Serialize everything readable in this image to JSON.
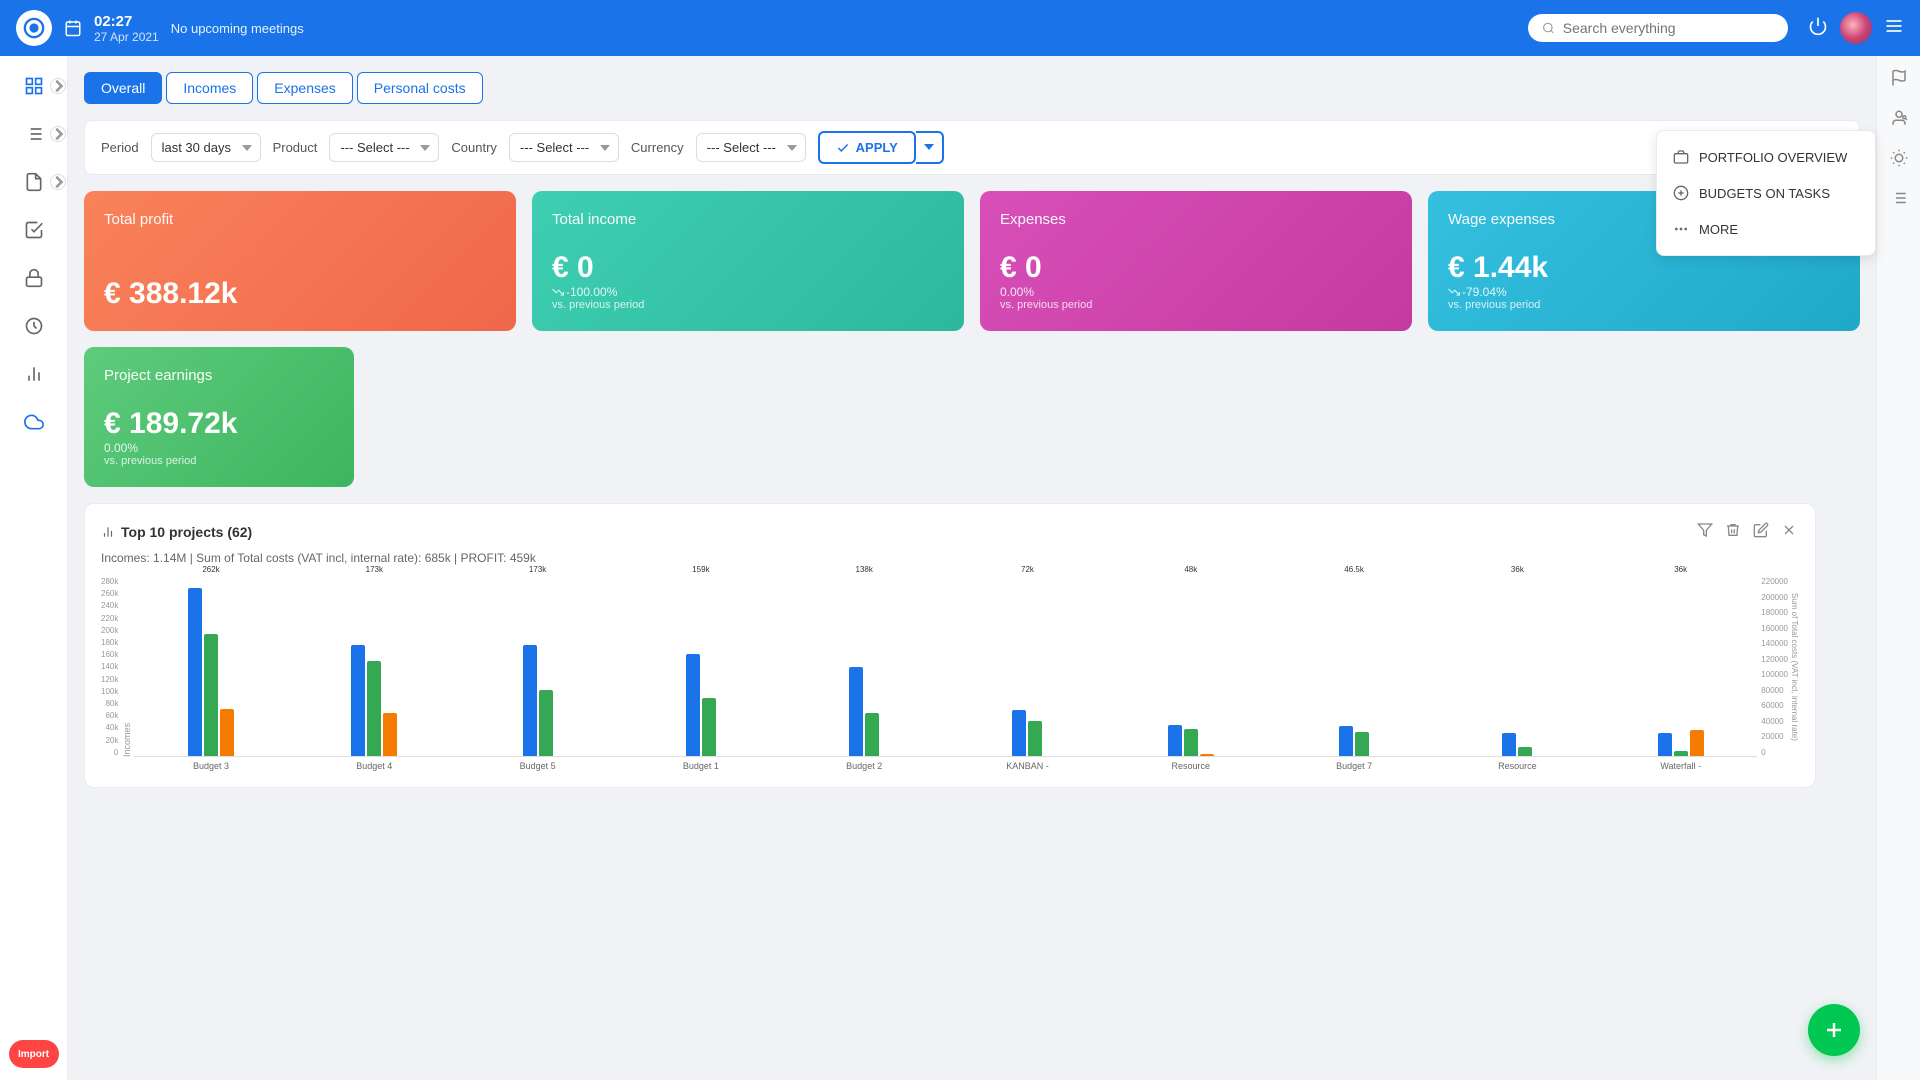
{
  "topnav": {
    "time": "02:27",
    "meeting": "No upcoming meetings",
    "date": "27 Apr 2021",
    "search_placeholder": "Search everything"
  },
  "tabs": {
    "items": [
      {
        "label": "Overall",
        "active": true
      },
      {
        "label": "Incomes",
        "active": false
      },
      {
        "label": "Expenses",
        "active": false
      },
      {
        "label": "Personal costs",
        "active": false
      }
    ]
  },
  "filters": {
    "period_label": "Period",
    "period_value": "last 30 days",
    "product_label": "Product",
    "product_placeholder": "--- Select ---",
    "country_label": "Country",
    "country_placeholder": "--- Select ---",
    "currency_label": "Currency",
    "currency_placeholder": "--- Select ---",
    "apply_label": "APPLY"
  },
  "kpi": {
    "total_profit": {
      "title": "Total profit",
      "value": "€ 388.12k",
      "change": "",
      "sub": ""
    },
    "total_income": {
      "title": "Total income",
      "value": "€ 0",
      "change": "-100.00%",
      "sub": "vs. previous period"
    },
    "expenses": {
      "title": "Expenses",
      "value": "€ 0",
      "change": "0.00%",
      "sub": "vs. previous period"
    },
    "wage_expenses": {
      "title": "Wage expenses",
      "value": "€ 1.44k",
      "change": "-79.04%",
      "sub": "vs. previous period"
    },
    "project_earnings": {
      "title": "Project earnings",
      "value": "€ 189.72k",
      "change": "0.00%",
      "sub": "vs. previous period"
    }
  },
  "chart": {
    "title": "Top 10 projects (62)",
    "subtitle": "Incomes: 1.14M | Sum of Total costs (VAT incl, internal rate): 685k | PROFIT: 459k",
    "y_labels": [
      "280k",
      "260k",
      "240k",
      "220k",
      "200k",
      "180k",
      "160k",
      "140k",
      "120k",
      "100k",
      "80k",
      "60k",
      "40k",
      "20k",
      "0"
    ],
    "bars": [
      {
        "label": "Budget 3",
        "blue": 262,
        "green": 189,
        "orange": 73.6
      },
      {
        "label": "Budget 4",
        "blue": 173,
        "green": 147,
        "orange": 66.3
      },
      {
        "label": "Budget 5",
        "blue": 173,
        "green": 103,
        "orange": 0
      },
      {
        "label": "Budget 1",
        "blue": 159,
        "green": 90.5,
        "orange": 0
      },
      {
        "label": "Budget 2",
        "blue": 138,
        "green": 67.4,
        "orange": 0
      },
      {
        "label": "KANBAN -",
        "blue": 72,
        "green": 55.2,
        "orange": 0
      },
      {
        "label": "Resource",
        "blue": 48,
        "green": 41.8,
        "orange": 3.2
      },
      {
        "label": "Budget 7",
        "blue": 46.5,
        "green": 36.69,
        "orange": 0
      },
      {
        "label": "Resource",
        "blue": 36,
        "green": 14.4,
        "orange": 0
      },
      {
        "label": "Waterfall -",
        "blue": 36,
        "green": 7.6,
        "orange": 40
      }
    ],
    "max": 280
  },
  "right_panel": {
    "items": [
      {
        "label": "PORTFOLIO OVERVIEW"
      },
      {
        "label": "BUDGETS ON TASKS"
      },
      {
        "label": "MORE"
      }
    ]
  },
  "sidebar": {
    "items": [
      {
        "name": "grid-icon",
        "label": "Dashboard"
      },
      {
        "name": "list-icon",
        "label": "Projects"
      },
      {
        "name": "doc-icon",
        "label": "Documents"
      },
      {
        "name": "check-icon",
        "label": "Tasks"
      },
      {
        "name": "lock-icon",
        "label": "Security"
      },
      {
        "name": "calendar-icon",
        "label": "Calendar"
      },
      {
        "name": "chart-icon",
        "label": "Reports"
      },
      {
        "name": "cloud-icon",
        "label": "Cloud"
      }
    ]
  },
  "fab": {
    "label": "+"
  }
}
